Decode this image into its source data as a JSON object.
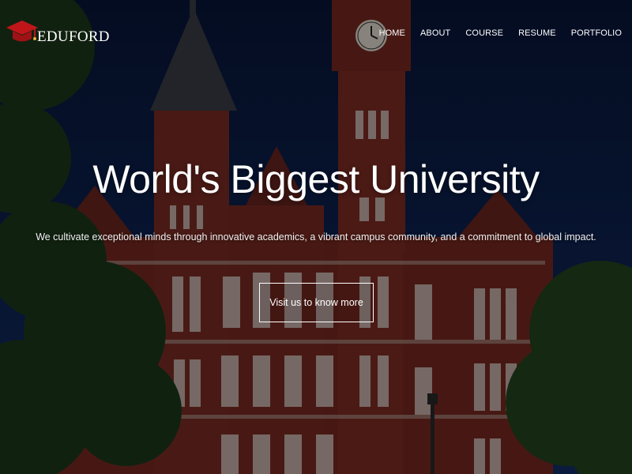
{
  "brand": {
    "name": "EDUFORD",
    "icon": "graduation-cap-icon",
    "icon_color": "#c0161a"
  },
  "nav": {
    "items": [
      {
        "label": "HOME"
      },
      {
        "label": "ABOUT"
      },
      {
        "label": "COURSE"
      },
      {
        "label": "RESUME"
      },
      {
        "label": "PORTFOLIO"
      }
    ]
  },
  "hero": {
    "headline": "World's Biggest University",
    "subline": "We cultivate exceptional minds through innovative academics, a vibrant campus community, and a commitment to global impact.",
    "cta_label": "Visit us to know more",
    "background": "university-building-image"
  },
  "colors": {
    "sky": "#0b1a3c",
    "brick": "#7a2a22",
    "foliage": "#22401f",
    "text": "#ffffff"
  }
}
